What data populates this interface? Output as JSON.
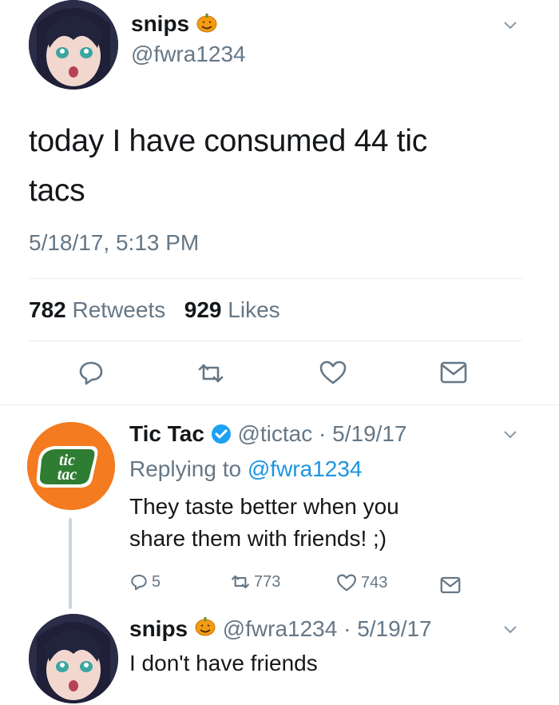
{
  "main_tweet": {
    "display_name": "snips",
    "handle": "@fwra1234",
    "text": "today I have consumed 44 tic tacs",
    "timestamp": "5/18/17, 5:13 PM",
    "retweets_count": "782",
    "retweets_label": "Retweets",
    "likes_count": "929",
    "likes_label": "Likes"
  },
  "reply": {
    "display_name": "Tic Tac",
    "handle": "@tictac",
    "date": "5/19/17",
    "separator": "·",
    "replying_to_prefix": "Replying to",
    "replying_to_handle": "@fwra1234",
    "text_line1": "They taste better when you",
    "text_line2": "share them with friends! ;)",
    "reply_count": "5",
    "retweet_count": "773",
    "like_count": "743",
    "logo_line1": "tic",
    "logo_line2": "tac"
  },
  "second_reply": {
    "display_name": "snips",
    "handle": "@fwra1234",
    "separator": "·",
    "date": "5/19/17",
    "text": "I don't have friends"
  },
  "colors": {
    "text": "#14171a",
    "muted": "#657786",
    "link": "#1b95e0",
    "verified": "#1da1f2",
    "tictac_orange": "#f47b20",
    "tictac_green": "#2e7d32",
    "pumpkin": "#f39c12"
  },
  "icons": [
    "reply-icon",
    "retweet-icon",
    "like-icon",
    "share-icon",
    "chevron-down-icon",
    "verified-icon",
    "pumpkin-icon"
  ]
}
